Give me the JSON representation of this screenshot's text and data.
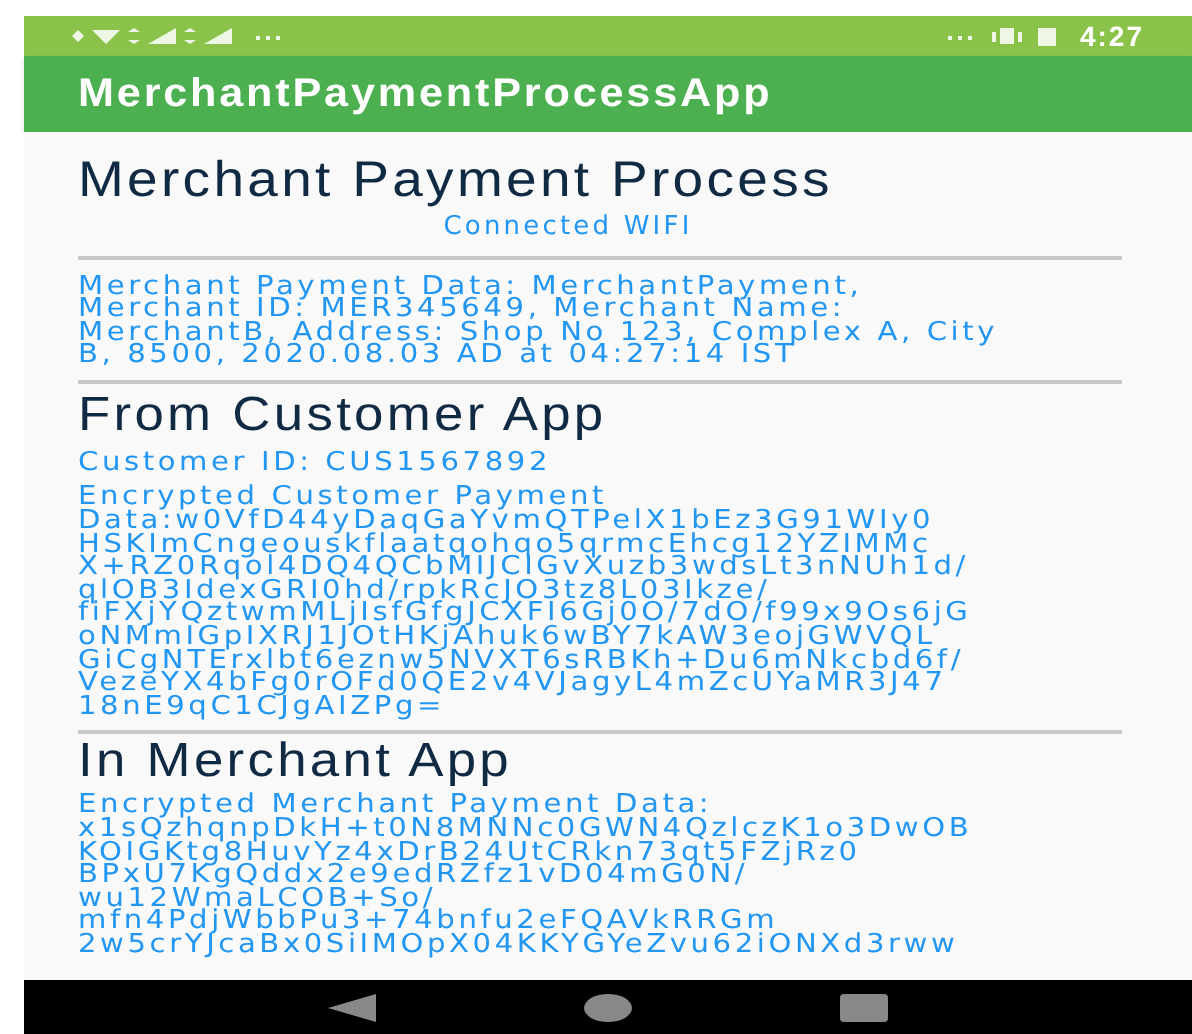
{
  "status_bar": {
    "time": "4:27"
  },
  "app_bar": {
    "title": "MerchantPaymentProcessApp"
  },
  "header": {
    "title": "Merchant Payment Process",
    "connection": "Connected WIFI"
  },
  "merchant_data": {
    "lines": [
      "Merchant Payment Data: MerchantPayment,",
      "Merchant ID: MER345649, Merchant Name:",
      "MerchantB, Address: Shop No 123, Complex A, City",
      "B, 8500, 2020.08.03 AD at 04:27:14 IST"
    ]
  },
  "customer_section": {
    "title": "From Customer App",
    "customer_id": "Customer ID: CUS1567892",
    "encrypted_lines": [
      "Encrypted Customer Payment",
      "Data:w0VfD44yDaqGaYvmQTPelX1bEz3G91WIy0",
      "HSKImCngeouskflaatqohqo5qrmcEhcg12YZIMMc",
      "X+RZ0Rqol4DQ4QCbMIJCIGvXuzb3wdsLt3nNUh1d/",
      "qlOB3IdexGRI0hd/rpkRcJO3tz8L03Ikze/",
      "fiFXjYQztwmMLjIsfGfgJCXFI6Gj0O/7dO/f99x9Os6jG",
      "oNMmIGpIXRJ1JOtHKjAhuk6wBY7kAW3eojGWVQL",
      "GiCgNTErxlbt6eznw5NVXT6sRBKh+Du6mNkcbd6f/",
      "VezeYX4bFg0rOFd0QE2v4VJagyL4mZcUYaMR3J47",
      "18nE9qC1CJgAIZPg="
    ]
  },
  "merchant_section": {
    "title": "In Merchant App",
    "encrypted_lines": [
      "Encrypted Merchant Payment Data:",
      "x1sQzhqnpDkH+t0N8MNNc0GWN4QzlczK1o3DwOB",
      "KOIGKtg8HuvYz4xDrB24UtCRkn73qt5FZjRz0",
      "BPxU7KgQddx2e9edRZfz1vD04mG0N/",
      "wu12WmaLCOB+So/",
      "mfn4PdjWbbPu3+74bnfu2eFQAVkRRGm",
      "2w5crYJcaBx0SiIMOpX04KKYGYeZvu62iONXd3rww"
    ]
  }
}
